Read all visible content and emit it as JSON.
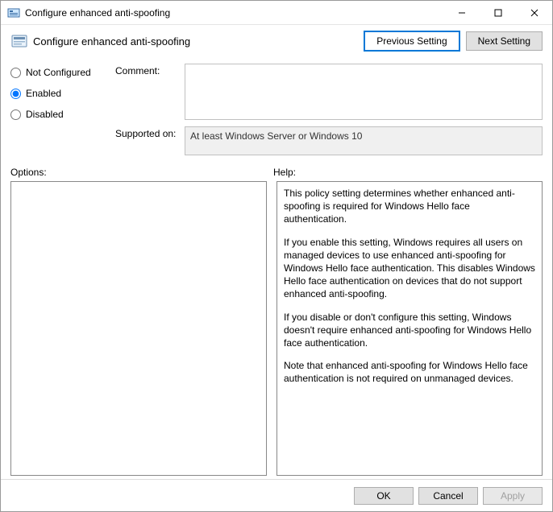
{
  "window": {
    "title": "Configure enhanced anti-spoofing"
  },
  "header": {
    "title": "Configure enhanced anti-spoofing",
    "previous": "Previous Setting",
    "next": "Next Setting"
  },
  "state": {
    "not_configured": "Not Configured",
    "enabled": "Enabled",
    "disabled": "Disabled",
    "selected": "enabled"
  },
  "fields": {
    "comment_label": "Comment:",
    "comment_value": "",
    "supported_label": "Supported on:",
    "supported_value": "At least Windows Server or Windows 10"
  },
  "labels": {
    "options": "Options:",
    "help": "Help:"
  },
  "help": {
    "p1": "This policy setting determines whether enhanced anti-spoofing is required for Windows Hello face authentication.",
    "p2": "If you enable this setting, Windows requires all users on managed devices to use enhanced anti-spoofing for Windows Hello face authentication. This disables Windows Hello face authentication on devices that do not support enhanced anti-spoofing.",
    "p3": "If you disable or don't configure this setting, Windows doesn't require enhanced anti-spoofing for Windows Hello face authentication.",
    "p4": "Note that enhanced anti-spoofing for Windows Hello face authentication is not required on unmanaged devices."
  },
  "footer": {
    "ok": "OK",
    "cancel": "Cancel",
    "apply": "Apply"
  }
}
